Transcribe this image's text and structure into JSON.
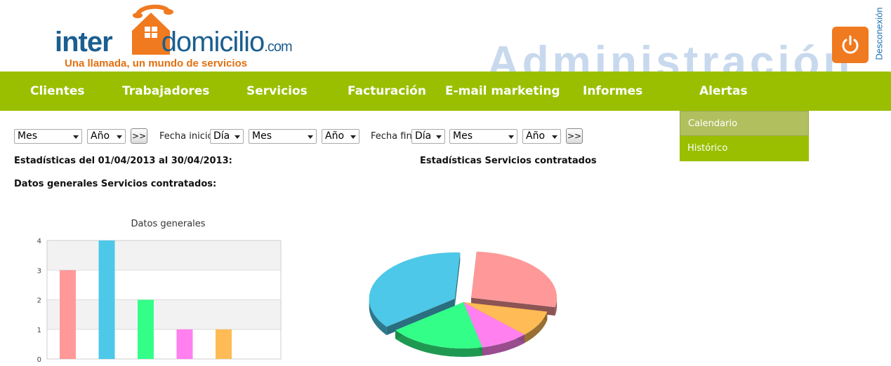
{
  "header": {
    "logo": {
      "part1": "inter",
      "part2": "domicilio",
      "part3": ".com",
      "tagline": "Una llamada, un mundo de servicios"
    },
    "watermark": "Administración",
    "logout_label": "Desconexión",
    "power_icon": "power-icon"
  },
  "nav": {
    "items": [
      {
        "label": "Clientes"
      },
      {
        "label": "Trabajadores"
      },
      {
        "label": "Servicios"
      },
      {
        "label": "Facturación"
      },
      {
        "label": "E-mail marketing"
      },
      {
        "label": "Informes"
      },
      {
        "label": "Alertas"
      }
    ],
    "dropdown": [
      {
        "label": "Calendario"
      },
      {
        "label": "Histórico"
      }
    ]
  },
  "filters": {
    "first": {
      "mes": "Mes",
      "anio": "Año",
      "go": ">>"
    },
    "fecha_inicio_label": "Fecha inicio",
    "inicio": {
      "dia": "Día",
      "mes": "Mes",
      "anio": "Año"
    },
    "fecha_fin_label": "Fecha fin",
    "fin": {
      "dia": "Día",
      "mes": "Mes",
      "anio": "Año",
      "go": ">>"
    }
  },
  "stats": {
    "title": "Estadísticas del 01/04/2013 al 30/04/2013:",
    "services_title": "Estadísticas Servicios contratados",
    "general_title": "Datos generales Servicios contratados:"
  },
  "colors": {
    "nav_bg": "#9abf00",
    "accent_orange": "#f07a20",
    "bar_colors": [
      "#ff9999",
      "#4dc8e8",
      "#33ff88",
      "#ff80ee",
      "#ffbb55"
    ]
  },
  "chart_data": [
    {
      "type": "bar",
      "title": "Datos generales",
      "categories": [
        "",
        "",
        "",
        "",
        ""
      ],
      "values": [
        3,
        4,
        2,
        1,
        1
      ],
      "ylim": [
        0,
        4
      ],
      "yticks": [
        "0",
        "1",
        "2",
        "3",
        "4"
      ],
      "grid": true
    },
    {
      "type": "pie",
      "values": [
        3,
        1,
        1,
        2,
        4
      ],
      "colors": [
        "#ff9999",
        "#ffbb55",
        "#ff80ee",
        "#33ff88",
        "#4dc8e8"
      ],
      "exploded_slices": [
        0,
        4
      ],
      "style": "3d"
    }
  ]
}
